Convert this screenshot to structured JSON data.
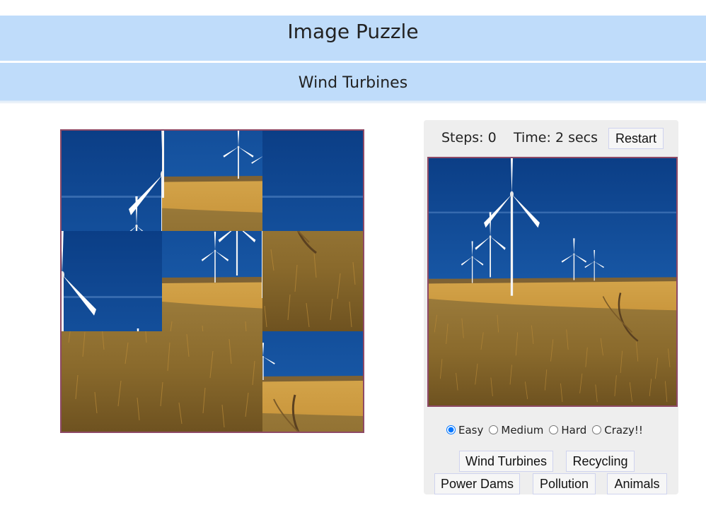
{
  "header": {
    "title": "Image Puzzle",
    "subtitle": "Wind Turbines"
  },
  "game": {
    "steps_label": "Steps: 0",
    "time_label": "Time: 2 secs",
    "restart_label": "Restart",
    "grid_size": 3,
    "tile_order": [
      0,
      4,
      2,
      1,
      3,
      8,
      6,
      7,
      5
    ]
  },
  "difficulty": {
    "options": [
      "Easy",
      "Medium",
      "Hard",
      "Crazy!!"
    ],
    "selected": "Easy"
  },
  "images": {
    "buttons": [
      "Wind Turbines",
      "Recycling",
      "Power Dams",
      "Pollution",
      "Animals"
    ]
  },
  "colors": {
    "header_bg": "#bfdcfa",
    "board_border": "#8e4a66",
    "panel_bg": "#eeeeee"
  }
}
